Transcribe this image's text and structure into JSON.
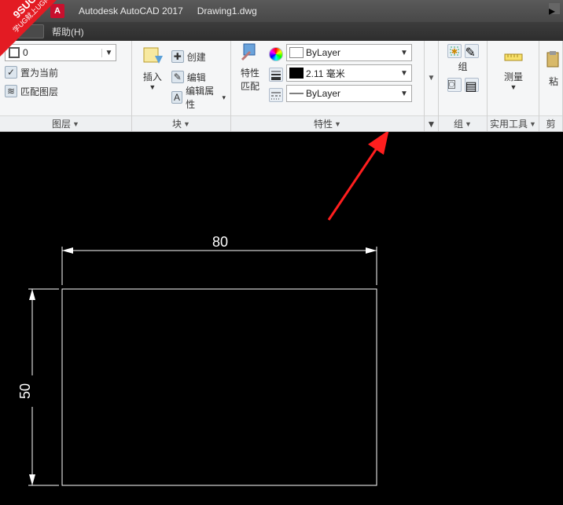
{
  "title": {
    "app": "Autodesk AutoCAD 2017",
    "file": "Drawing1.dwg"
  },
  "menu": {
    "help": "帮助(H)"
  },
  "ribbon": {
    "layers": {
      "title": "图层",
      "current": "0",
      "set_current": "置为当前",
      "match": "匹配图层"
    },
    "blocks": {
      "title": "块",
      "insert": "插入",
      "create": "创建",
      "edit": "编辑",
      "edit_attr": "编辑属性"
    },
    "properties": {
      "title": "特性",
      "match": "特性",
      "match2": "匹配",
      "color": "ByLayer",
      "lineweight": "2.11 毫米",
      "linetype": "ByLayer"
    },
    "groups": {
      "title": "组",
      "group": "组"
    },
    "utils": {
      "title": "实用工具",
      "measure": "测量"
    },
    "clipboard": {
      "title": "剪",
      "paste": "粘"
    }
  },
  "drawing": {
    "dim_h": "80",
    "dim_v": "50"
  }
}
